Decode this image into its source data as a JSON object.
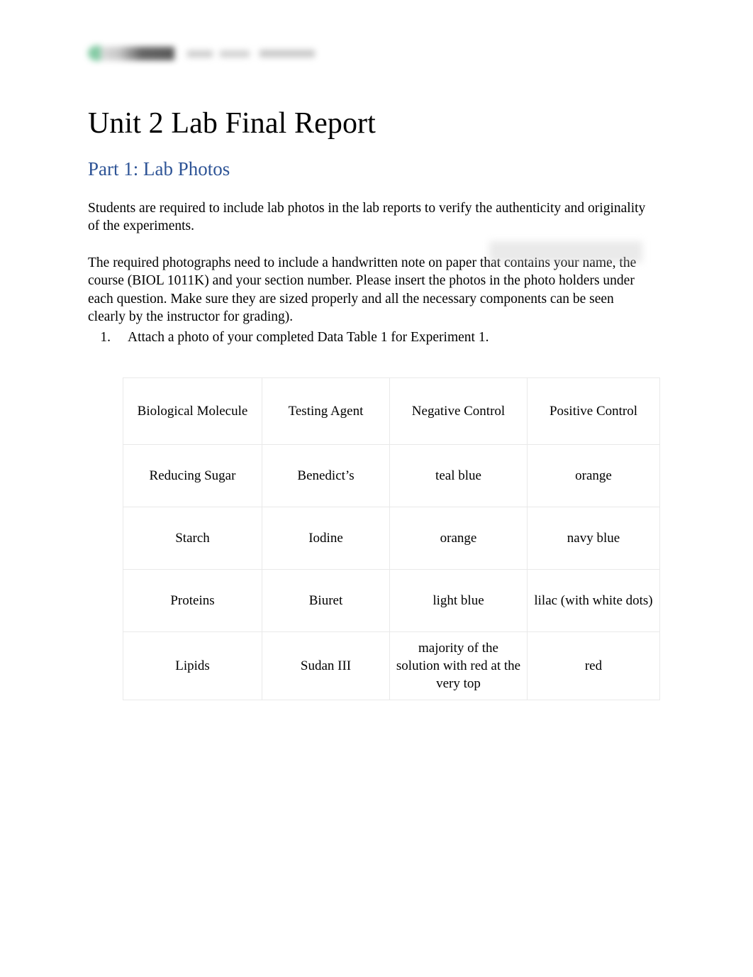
{
  "document": {
    "logo": {
      "icon": "green-circle-logo-mark",
      "redacted": true
    },
    "title": "Unit 2 Lab Final Report",
    "section_heading": "Part 1: Lab Photos",
    "paragraphs": [
      "Students are required to include lab photos in the lab reports to verify the authenticity and originality of the experiments.",
      "The required photographs need to include a handwritten note on paper that contains your name, the course (BIOL 1011K) and your section number. Please insert the photos in the photo holders under each question. Make sure they are sized properly and all the necessary components can be seen clearly by the instructor for grading)."
    ],
    "list": [
      {
        "number": "1.",
        "text": "Attach a photo of your completed Data Table 1 for Experiment 1."
      }
    ]
  },
  "data_table": {
    "headers": [
      "Biological Molecule",
      "Testing Agent",
      "Negative Control",
      "Positive Control"
    ],
    "rows": [
      {
        "molecule": "Reducing Sugar",
        "agent": "Benedict’s",
        "negative": "teal blue",
        "positive": "orange"
      },
      {
        "molecule": "Starch",
        "agent": "Iodine",
        "negative": "orange",
        "positive": "navy blue"
      },
      {
        "molecule": "Proteins",
        "agent": "Biuret",
        "negative": "light blue",
        "positive": "lilac (with white dots)"
      },
      {
        "molecule": "Lipids",
        "agent": "Sudan III",
        "negative": "majority of the solution with red at the very top",
        "positive": "red"
      }
    ]
  },
  "colors": {
    "page_background": "#ffffff",
    "body_text": "#000000",
    "heading_accent": "#2e5496",
    "table_border": "#e9e9e9",
    "logo_green": "#6fc295"
  }
}
